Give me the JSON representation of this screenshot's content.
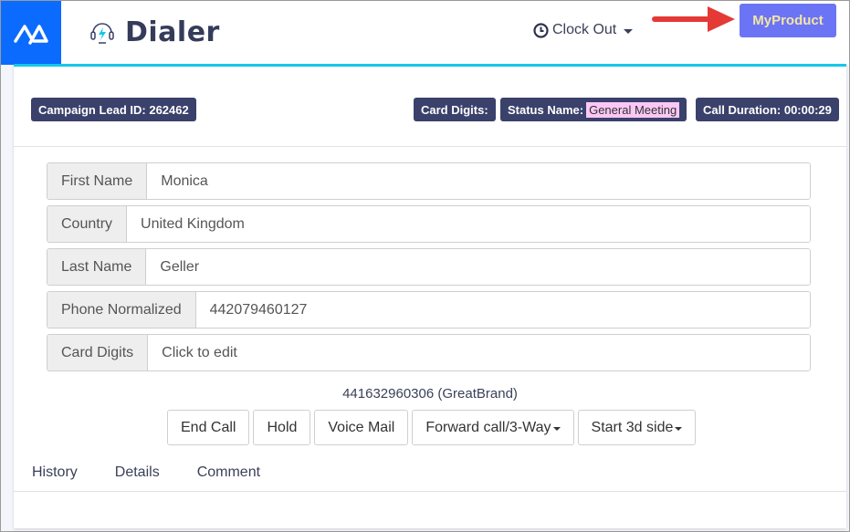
{
  "header": {
    "app_title": "Dialer",
    "clock_out_label": "Clock Out",
    "product_button_label": "MyProduct",
    "brand_color": "#0b6bff",
    "product_button_color": "#6b74f5",
    "accent_color": "#12c8e8"
  },
  "badges": {
    "campaign_lead": "Campaign Lead ID: 262462",
    "card_digits": "Card Digits:",
    "status_label": "Status Name:",
    "status_value": "General Meeting",
    "call_duration": "Call Duration: 00:00:29"
  },
  "form": {
    "fields": [
      {
        "label": "First Name",
        "value": "Monica"
      },
      {
        "label": "Country",
        "value": "United Kingdom"
      },
      {
        "label": "Last Name",
        "value": "Geller"
      },
      {
        "label": "Phone Normalized",
        "value": "442079460127"
      },
      {
        "label": "Card Digits",
        "value": "Click to edit"
      }
    ]
  },
  "call": {
    "caller_id": "441632960306 (GreatBrand)",
    "buttons": {
      "end_call": "End Call",
      "hold": "Hold",
      "voice_mail": "Voice Mail",
      "forward": "Forward call/3-Way",
      "start_3d": "Start 3d side"
    }
  },
  "tabs": [
    {
      "label": "History"
    },
    {
      "label": "Details"
    },
    {
      "label": "Comment"
    }
  ]
}
